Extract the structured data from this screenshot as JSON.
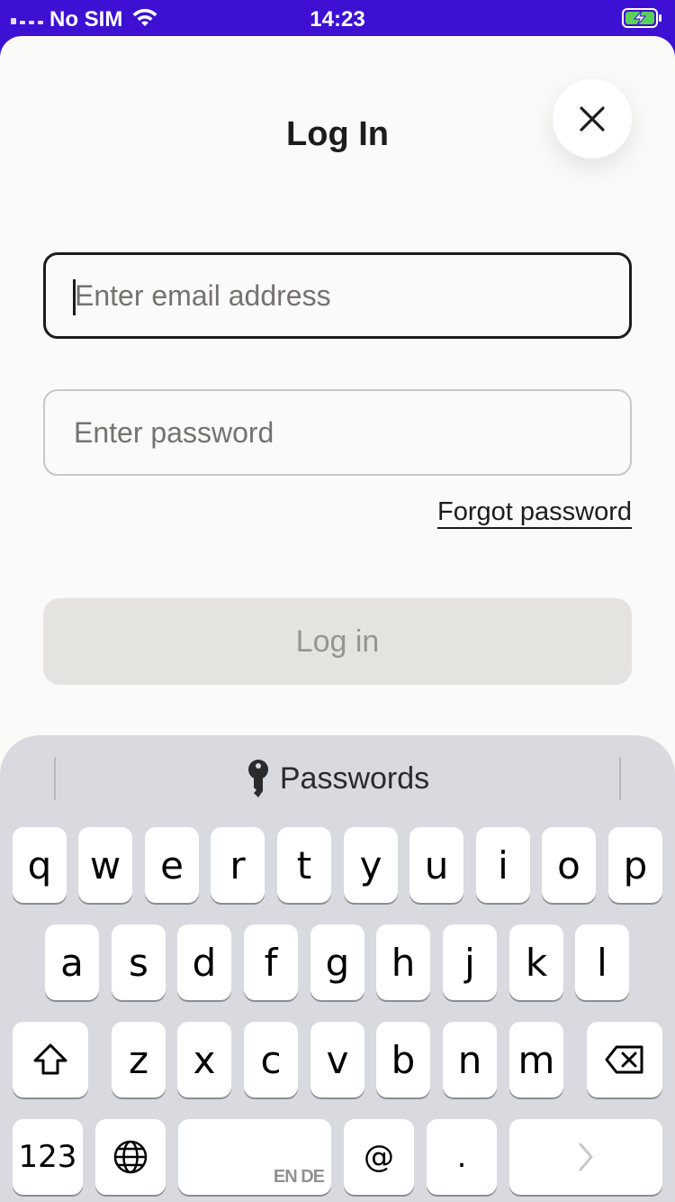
{
  "status_bar": {
    "carrier": "No SIM",
    "time": "14:23",
    "wifi_icon": "wifi-icon",
    "battery_icon": "battery-charging-icon"
  },
  "header": {
    "title": "Log In",
    "close_icon": "close-icon"
  },
  "form": {
    "email_placeholder": "Enter email address",
    "email_value": "",
    "password_placeholder": "Enter password",
    "password_value": "",
    "forgot_label": "Forgot password",
    "login_label": "Log in"
  },
  "keyboard": {
    "passwords_label": "Passwords",
    "passwords_icon": "key-icon",
    "row1": [
      "q",
      "w",
      "e",
      "r",
      "t",
      "y",
      "u",
      "i",
      "o",
      "p"
    ],
    "row2": [
      "a",
      "s",
      "d",
      "f",
      "g",
      "h",
      "j",
      "k",
      "l"
    ],
    "row3": [
      "z",
      "x",
      "c",
      "v",
      "b",
      "n",
      "m"
    ],
    "numbers_label": "123",
    "space_languages": "EN DE",
    "at_label": "@",
    "dot_label": "."
  },
  "colors": {
    "status_bar_bg": "#3d10d4",
    "sheet_bg": "#fafaf8",
    "disabled_button_bg": "#e4e3e0",
    "keyboard_bg": "#d8dadf"
  }
}
